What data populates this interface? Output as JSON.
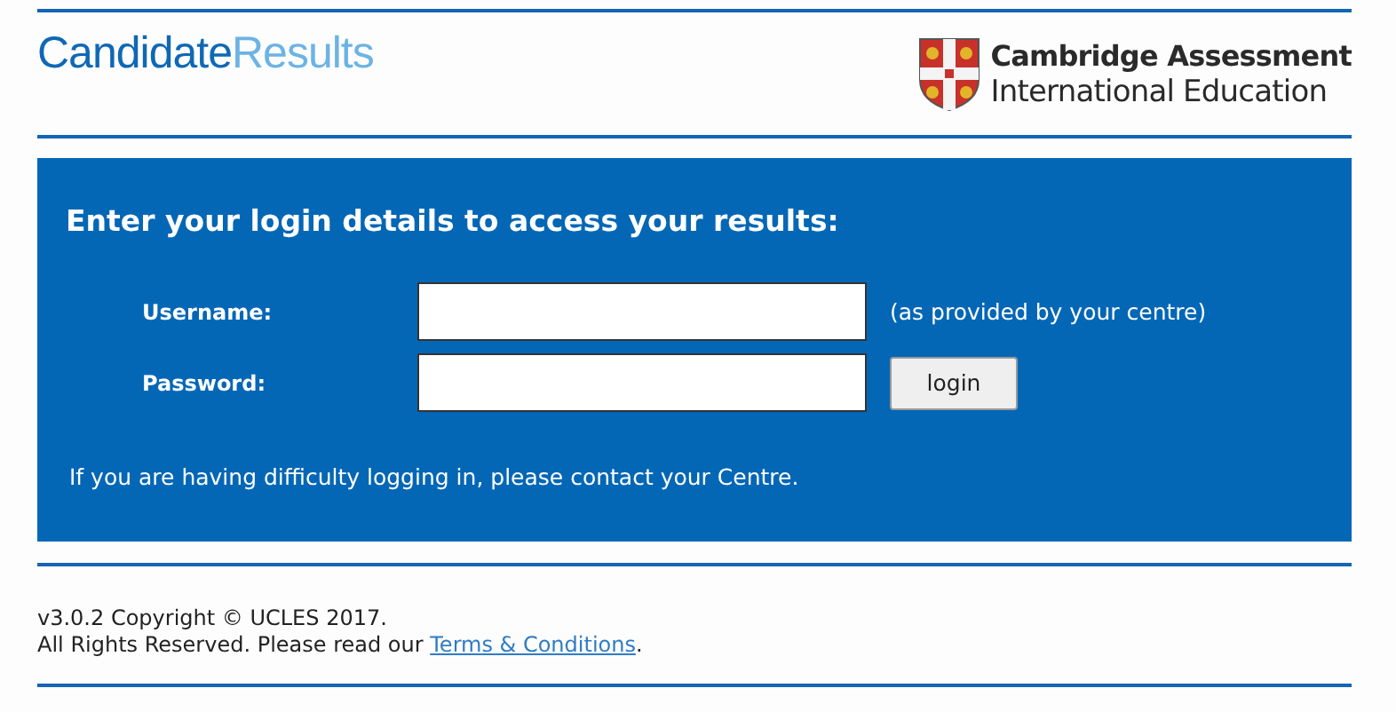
{
  "header": {
    "brand_primary": "Candidate",
    "brand_secondary": "Results",
    "org_line_1": "Cambridge Assessment",
    "org_line_2": "International Education"
  },
  "login": {
    "heading": "Enter your login details to access your results:",
    "fields": [
      {
        "label": "Username:",
        "hint": "(as provided by your centre)"
      },
      {
        "label": "Password:",
        "button": "login"
      }
    ],
    "help": "If you are having difficulty logging in, please contact your Centre."
  },
  "footer": {
    "line_1": "v3.0.2 Copyright © UCLES 2017.",
    "line_2": "All Rights Reserved. Please read our ",
    "link": "Terms & Conditions",
    "line_2_end": "."
  }
}
